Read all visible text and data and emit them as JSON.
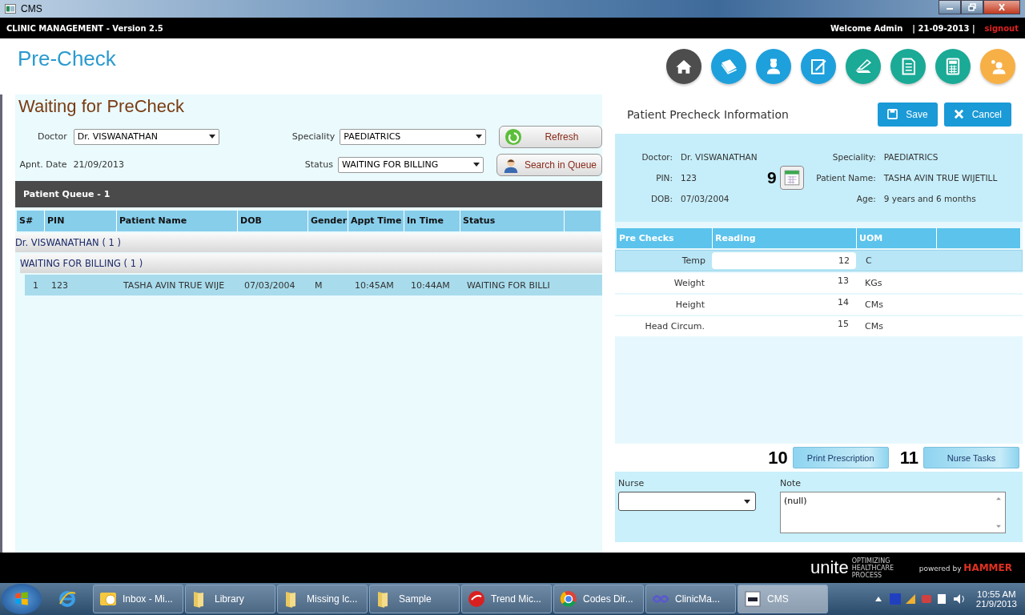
{
  "window": {
    "title": "CMS"
  },
  "app_header": {
    "title": "CLINIC MANAGEMENT - Version 2.5",
    "welcome": "Welcome Admin",
    "date": "| 21-09-2013 |",
    "signout": "signout"
  },
  "page_title": "Pre-Check",
  "nav_icons": [
    {
      "kind": "home",
      "color": "#4d4d4d"
    },
    {
      "kind": "book",
      "color": "#1ea0dc"
    },
    {
      "kind": "nurse",
      "color": "#1ea0dc"
    },
    {
      "kind": "edit",
      "color": "#1ea0dc"
    },
    {
      "kind": "scanner",
      "color": "#1aaa96"
    },
    {
      "kind": "document",
      "color": "#1aaa96"
    },
    {
      "kind": "calculator",
      "color": "#1aaa96"
    },
    {
      "kind": "user",
      "color": "#f7b046"
    }
  ],
  "waiting_panel": {
    "title": "Waiting for PreCheck",
    "doctor": {
      "label": "Doctor",
      "value": "Dr. VISWANATHAN"
    },
    "speciality": {
      "label": "Speciality",
      "value": "PAEDIATRICS"
    },
    "appointment_date": {
      "label": "Apnt. Date",
      "value": "21/09/2013"
    },
    "status": {
      "label": "Status",
      "value": "WAITING FOR BILLING"
    },
    "buttons": [
      {
        "kind": "refresh",
        "label": "Refresh"
      },
      {
        "kind": "search",
        "label": "Search in Queue"
      }
    ]
  },
  "patient_queue": {
    "title": "Patient Queue - 1",
    "columns": [
      "S#",
      "PIN",
      "Patient Name",
      "DOB",
      "Gender",
      "Appt Time",
      "In Time",
      "Status"
    ],
    "groups": [
      {
        "label": "Dr. VISWANATHAN ( 1 )",
        "children": [
          {
            "label": "WAITING FOR BILLING ( 1 )",
            "rows": [
              {
                "selected": true,
                "cells": [
                  "1",
                  "123",
                  "TASHA AVIN TRUE WIJE",
                  "07/03/2004",
                  "M",
                  "10:45AM",
                  "10:44AM",
                  "WAITING FOR BILLI"
                ]
              }
            ]
          }
        ]
      }
    ]
  },
  "precheck": {
    "title": "Patient Precheck Information",
    "buttons": [
      {
        "kind": "save",
        "label": "Save"
      },
      {
        "kind": "cancel",
        "label": "Cancel"
      }
    ],
    "info_left": [
      {
        "label": "Doctor:",
        "value": "Dr. VISWANATHAN"
      },
      {
        "label": "PIN:",
        "value": "123"
      },
      {
        "label": "DOB:",
        "value": "07/03/2004"
      }
    ],
    "info_right": [
      {
        "label": "Speciality:",
        "value": "PAEDIATRICS"
      },
      {
        "label": "Patient Name:",
        "value": "TASHA AVIN TRUE WIJETILL"
      },
      {
        "label": "Age:",
        "value": "9 years and 6 months"
      }
    ],
    "calendar_annotation": "9",
    "columns": [
      "Pre Checks",
      "Reading",
      "UOM"
    ],
    "rows": [
      {
        "name": "Temp",
        "reading": "12",
        "uom": "C",
        "selected": true
      },
      {
        "name": "Weight",
        "reading": "13",
        "uom": "KGs",
        "selected": false
      },
      {
        "name": "Height",
        "reading": "14",
        "uom": "CMs",
        "selected": false
      },
      {
        "name": "Head Circum.",
        "reading": "15",
        "uom": "CMs",
        "selected": false
      }
    ],
    "actions": [
      {
        "annotation": "10",
        "label": "Print Prescription"
      },
      {
        "annotation": "11",
        "label": "Nurse Tasks"
      }
    ],
    "nurse": {
      "label": "Nurse"
    },
    "note": {
      "label": "Note",
      "value": "(null)"
    }
  },
  "footer": {
    "logo": "unite",
    "tagline": "OPTIMIZING HEALTHCARE PROCESS",
    "powered_by": "powered by **HAMMER**"
  },
  "taskbar": {
    "apps": [
      {
        "kind": "mail",
        "label": "Inbox - Mi...",
        "selected": false
      },
      {
        "kind": "folder",
        "label": "Library",
        "selected": false
      },
      {
        "kind": "folder",
        "label": "Missing Ic...",
        "selected": false
      },
      {
        "kind": "folder",
        "label": "Sample",
        "selected": false
      },
      {
        "kind": "shield",
        "label": "Trend Mic...",
        "selected": false
      },
      {
        "kind": "browser",
        "label": "Codes Dir...",
        "selected": false
      },
      {
        "kind": "infinity",
        "label": "ClinicMa...",
        "selected": false
      },
      {
        "kind": "window",
        "label": "CMS",
        "selected": true
      }
    ],
    "time": "10:55 AM",
    "date": "21/9/2013"
  }
}
